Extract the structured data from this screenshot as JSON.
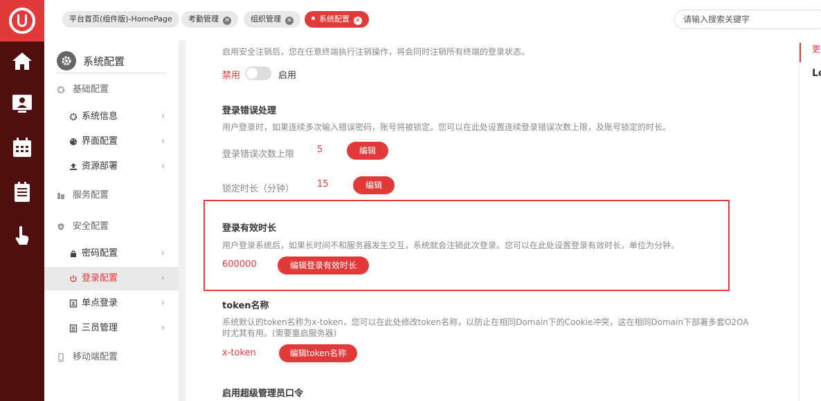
{
  "tabs": [
    {
      "label": "平台首页(组件版)-HomePage",
      "closable": false,
      "active": false
    },
    {
      "label": "考勤管理",
      "closable": true,
      "active": false
    },
    {
      "label": "组织管理",
      "closable": true,
      "active": false
    },
    {
      "label": "系统配置",
      "closable": true,
      "active": true
    }
  ],
  "search": {
    "placeholder": "请输入搜索关键字"
  },
  "sidebar": {
    "title": "系统配置",
    "items": [
      {
        "label": "基础配置",
        "level": "group"
      },
      {
        "label": "系统信息",
        "level": "sub"
      },
      {
        "label": "界面配置",
        "level": "sub"
      },
      {
        "label": "资源部署",
        "level": "sub"
      },
      {
        "label": "服务配置",
        "level": "group"
      },
      {
        "label": "安全配置",
        "level": "group"
      },
      {
        "label": "密码配置",
        "level": "sub"
      },
      {
        "label": "登录配置",
        "level": "sub",
        "selected": true
      },
      {
        "label": "单点登录",
        "level": "sub"
      },
      {
        "label": "三员管理",
        "level": "sub"
      },
      {
        "label": "移动端配置",
        "level": "group"
      }
    ]
  },
  "content": {
    "top_desc": "启用安全注销后，您在任意终端执行注销操作，将会同时注销所有终端的登录状态。",
    "toggle": {
      "off": "禁用",
      "on": "启用",
      "enabled": false
    },
    "login_error": {
      "title": "登录错误处理",
      "desc": "用户登录时，如果连续多次输入错误密码，账号将被锁定。您可以在此处设置连续登录错误次数上限，及账号锁定的时长。",
      "limit_label": "登录错误次数上限",
      "limit_value": "5",
      "lock_label": "锁定时长（分钟）",
      "lock_value": "15",
      "edit": "编辑"
    },
    "session": {
      "title": "登录有效时长",
      "desc": "用户登录系统后，如果长时间不和服务器发生交互，系统就会注销此次登录。您可以在此处设置登录有效时长，单位为分钟。",
      "value": "600000",
      "button": "编辑登录有效时长"
    },
    "token": {
      "title": "token名称",
      "desc1": "系统默认的token名称为x-token，您可以在此处修改token名称，以防止在相同Domain下的Cookie冲突，这在相同Domain下部署多套O2OA",
      "desc2": "时尤其有用。(需要重启服务器)",
      "value": "x-token",
      "button": "编辑token名称"
    },
    "super_admin": {
      "title": "启用超级管理员口令"
    }
  },
  "right_panel": {
    "text1": "更",
    "text2": "Lo"
  },
  "colors": {
    "accent": "#e23a3a",
    "rail": "#4f0f0f"
  }
}
